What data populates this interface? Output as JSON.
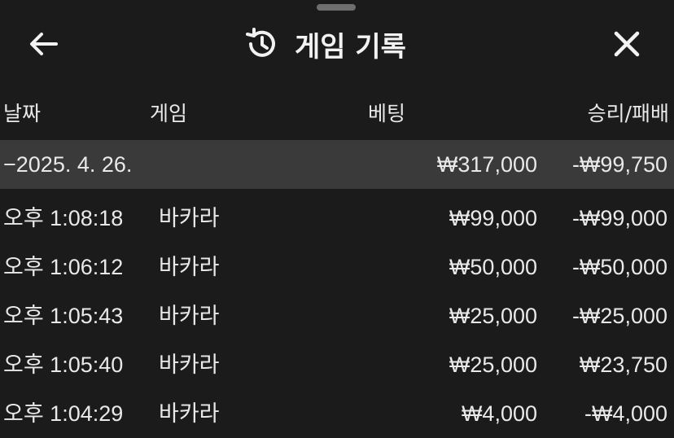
{
  "header": {
    "title": "게임 기록",
    "back_icon": "arrow-left-icon",
    "history_icon": "history-clock-icon",
    "close_icon": "close-icon"
  },
  "columns": {
    "date": "날짜",
    "game": "게임",
    "bet": "베팅",
    "result": "승리/패배"
  },
  "summary_row": {
    "date": "−2025. 4. 26.",
    "bet": "₩317,000",
    "result": "-₩99,750"
  },
  "rows": [
    {
      "time": "오후 1:08:18",
      "game": "바카라",
      "bet": "₩99,000",
      "result": "-₩99,000"
    },
    {
      "time": "오후 1:06:12",
      "game": "바카라",
      "bet": "₩50,000",
      "result": "-₩50,000"
    },
    {
      "time": "오후 1:05:43",
      "game": "바카라",
      "bet": "₩25,000",
      "result": "-₩25,000"
    },
    {
      "time": "오후 1:05:40",
      "game": "바카라",
      "bet": "₩25,000",
      "result": "₩23,750"
    },
    {
      "time": "오후 1:04:29",
      "game": "바카라",
      "bet": "₩4,000",
      "result": "-₩4,000"
    }
  ],
  "colors": {
    "background": "#1b1b1b",
    "group_row": "#3a3a3a",
    "text": "#e9e9e9"
  }
}
